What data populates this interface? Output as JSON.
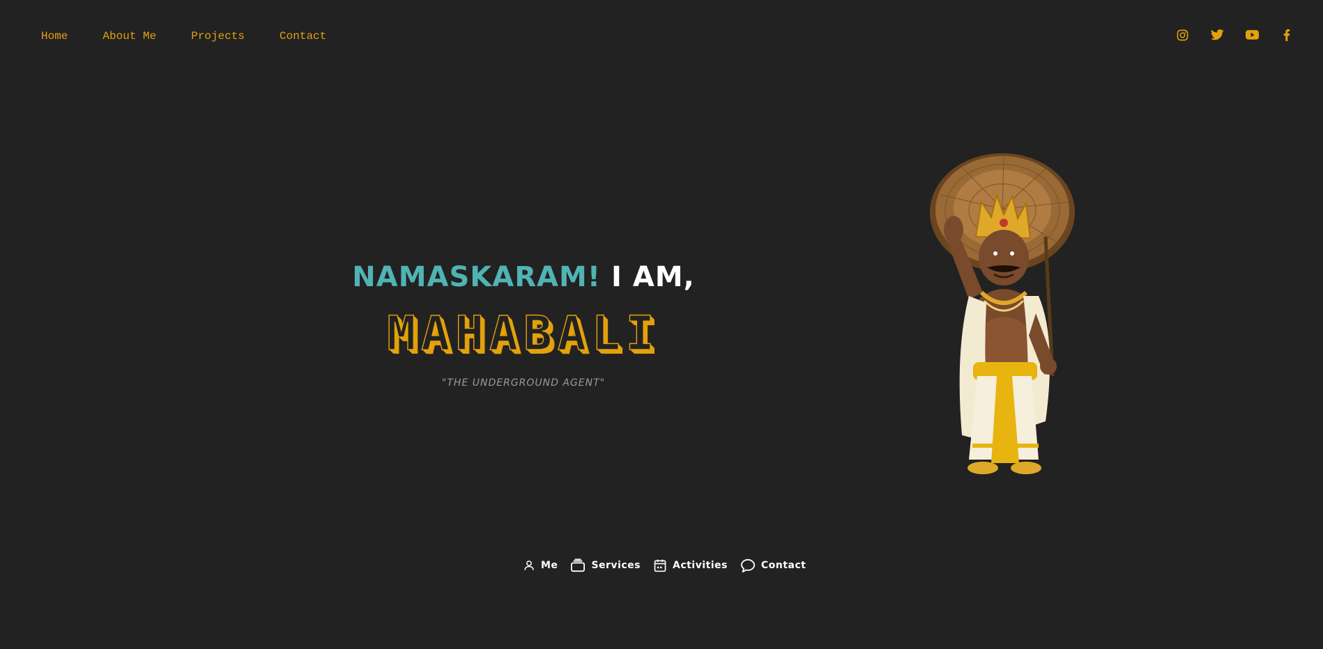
{
  "nav": {
    "links": [
      "Home",
      "About Me",
      "Projects",
      "Contact"
    ]
  },
  "socials": {
    "icons": [
      "instagram-icon",
      "twitter-icon",
      "youtube-icon",
      "facebook-icon"
    ]
  },
  "hero": {
    "greeting_primary": "NAMASKARAM!",
    "greeting_secondary": "I AM,",
    "name": "MAHABALI",
    "tagline": "\"THE UNDERGROUND AGENT\""
  },
  "bottom_nav": {
    "items": [
      {
        "label": "Me",
        "icon": "user-icon"
      },
      {
        "label": "Services",
        "icon": "briefcase-icon"
      },
      {
        "label": "Activities",
        "icon": "calendar-icon"
      },
      {
        "label": "Contact",
        "icon": "chat-bubble-icon"
      }
    ]
  },
  "colors": {
    "background": "#222222",
    "accent": "#e3a20c",
    "teal": "#51b3b3",
    "text": "#ffffff",
    "muted": "#9a9a9a"
  }
}
